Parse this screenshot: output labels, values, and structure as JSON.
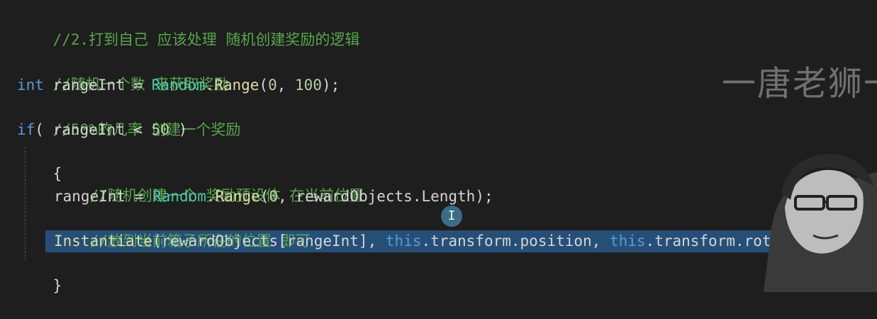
{
  "code": {
    "line1_comment": "//2.打到自己 应该处理 随机创建奖励的逻辑",
    "line2_comment": "//随机一个数 来获取奖励",
    "line3": {
      "type": "int",
      "var": "rangeInt",
      "eq": " = ",
      "cls": "Random",
      "dot": ".",
      "method": "Range",
      "args_open": "(",
      "arg1": "0",
      "comma": ", ",
      "arg2": "100",
      "close": ");"
    },
    "line4_comment": "//50%的几率 创建一个奖励",
    "line5": {
      "kw": "if",
      "paren": "( ",
      "var": "rangeInt",
      "op": " < ",
      "num": "50",
      "close": " )"
    },
    "line6_brace": "{",
    "line7_comment": "//随机创建一个 奖励预设体 在当前位置",
    "line8": {
      "var": "rangeInt",
      "eq": " = ",
      "cls": "Random",
      "dot": ".",
      "method": "Range",
      "open": "(",
      "arg1": "0",
      "comma": ", ",
      "arg2": "rewardObjects",
      "dot2": ".",
      "prop": "Length",
      "close": ");"
    },
    "line9_comment": "//放到当前箱子所在的位置 即可",
    "line10": {
      "method": "Instantiate",
      "open": "(",
      "arr": "rewardObjects",
      "idx_open": "[",
      "idx": "rangeInt",
      "idx_close": "]",
      "comma1": ", ",
      "this1": "this",
      "pos": ".transform.position",
      "comma2": ", ",
      "this2": "this",
      "rot": ".transform.rotation",
      "close": ")",
      "semi": ";"
    },
    "line11_brace": "}"
  },
  "watermark": "一唐老狮一",
  "cursor_icon": "I"
}
